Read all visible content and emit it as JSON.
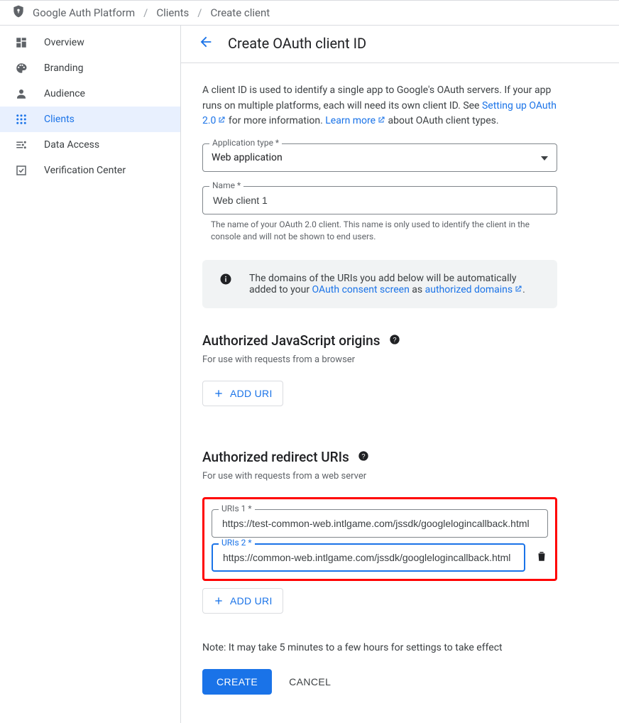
{
  "breadcrumbs": {
    "root": "Google Auth Platform",
    "mid": "Clients",
    "leaf": "Create client"
  },
  "sidebar": {
    "items": [
      {
        "label": "Overview"
      },
      {
        "label": "Branding"
      },
      {
        "label": "Audience"
      },
      {
        "label": "Clients"
      },
      {
        "label": "Data Access"
      },
      {
        "label": "Verification Center"
      }
    ]
  },
  "header": {
    "title": "Create OAuth client ID"
  },
  "intro": {
    "pre": "A client ID is used to identify a single app to Google's OAuth servers. If your app runs on multiple platforms, each will need its own client ID. See ",
    "link1": "Setting up OAuth 2.0",
    "mid": " for more information. ",
    "link2": "Learn more",
    "post": " about OAuth client types."
  },
  "appType": {
    "label": "Application type *",
    "value": "Web application"
  },
  "nameField": {
    "label": "Name *",
    "value": "Web client 1",
    "helper": "The name of your OAuth 2.0 client. This name is only used to identify the client in the console and will not be shown to end users."
  },
  "infobox": {
    "pre": "The domains of the URIs you add below will be automatically added to your ",
    "link1": "OAuth consent screen",
    "mid": " as ",
    "link2": "authorized domains",
    "post": "."
  },
  "jsOrigins": {
    "title": "Authorized JavaScript origins",
    "sub": "For use with requests from a browser",
    "addBtn": "ADD URI"
  },
  "redirect": {
    "title": "Authorized redirect URIs",
    "sub": "For use with requests from a web server",
    "uri1": {
      "label": "URIs 1 *",
      "value": "https://test-common-web.intlgame.com/jssdk/googlelogincallback.html"
    },
    "uri2": {
      "label": "URIs 2 *",
      "value": "https://common-web.intlgame.com/jssdk/googlelogincallback.html"
    },
    "addBtn": "ADD URI"
  },
  "note": "Note: It may take 5 minutes to a few hours for settings to take effect",
  "actions": {
    "create": "CREATE",
    "cancel": "CANCEL"
  }
}
